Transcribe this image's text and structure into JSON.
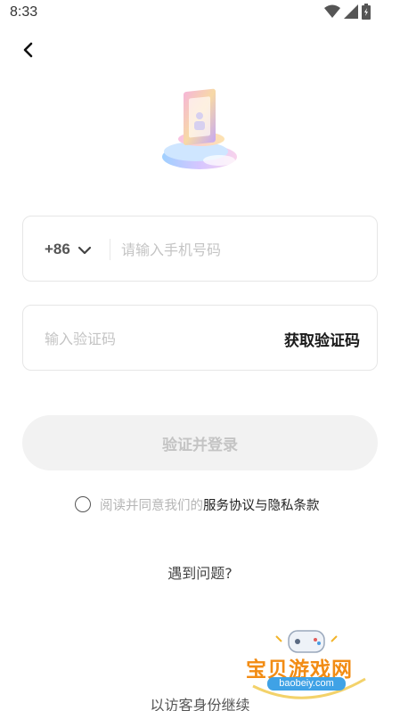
{
  "status_bar": {
    "time": "8:33",
    "icons": [
      "wifi-icon",
      "signal-icon",
      "battery-icon"
    ]
  },
  "header": {
    "back_icon": "chevron-left-icon"
  },
  "phone": {
    "country_code": "+86",
    "placeholder": "请输入手机号码",
    "value": ""
  },
  "code": {
    "placeholder": "输入验证码",
    "value": "",
    "get_code_label": "获取验证码"
  },
  "login": {
    "label": "验证并登录",
    "enabled": false
  },
  "agreement": {
    "prefix": "阅读并同意我们的",
    "link": "服务协议与隐私条款",
    "checked": false
  },
  "help": {
    "label": "遇到问题?"
  },
  "guest": {
    "label": "以访客身份继续"
  },
  "watermark": {
    "title": "宝贝游戏网",
    "url": "baobeiy.com"
  },
  "colors": {
    "accent_disabled_bg": "#f2f2f2",
    "accent_disabled_text": "#c4c4c4",
    "border": "#e6e6e6",
    "placeholder": "#c4c4c4"
  }
}
